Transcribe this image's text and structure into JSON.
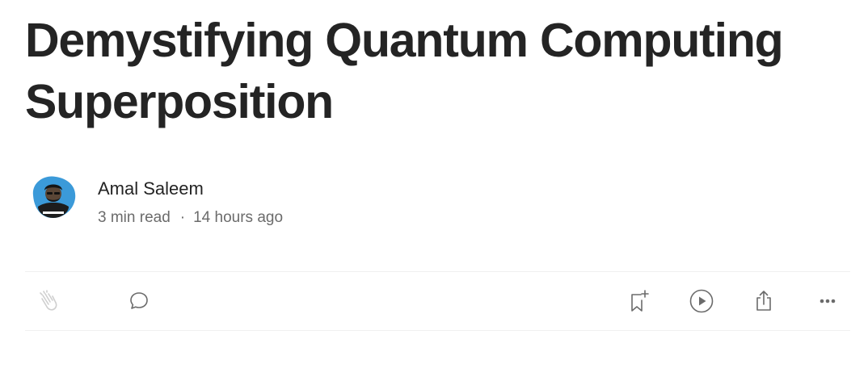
{
  "article": {
    "title": "Demystifying Quantum Computing Superposition"
  },
  "author": {
    "name": "Amal Saleem",
    "read_time": "3 min read",
    "separator": "·",
    "published": "14 hours ago"
  },
  "actions": {
    "left": [
      "clap-icon",
      "comment-icon"
    ],
    "right": [
      "bookmark-add-icon",
      "play-icon",
      "share-icon",
      "more-icon"
    ]
  },
  "colors": {
    "text": "#242424",
    "muted": "#6b6b6b",
    "divider": "#f0f0f0",
    "avatar_blue": "#3b9ad9"
  }
}
